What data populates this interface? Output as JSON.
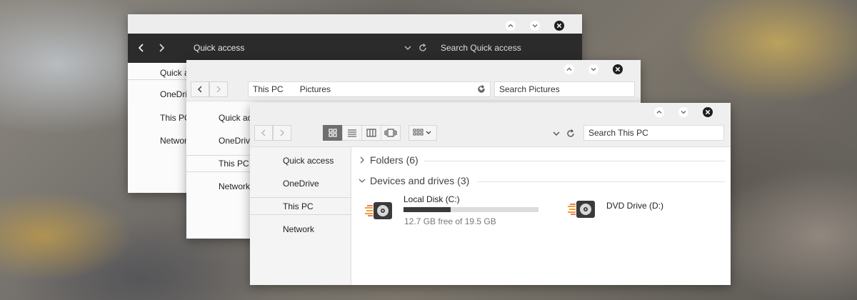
{
  "window_back": {
    "address": "Quick access",
    "search_placeholder": "Search Quick access",
    "sidebar": [
      "Quick access",
      "OneDrive",
      "This PC",
      "Network"
    ]
  },
  "window_middle": {
    "breadcrumb": [
      "This PC",
      "Pictures"
    ],
    "search_placeholder": "Search Pictures",
    "sidebar": [
      "Quick access",
      "OneDrive",
      "This PC",
      "Network"
    ]
  },
  "window_front": {
    "search_placeholder": "Search This PC",
    "sidebar": [
      "Quick access",
      "OneDrive",
      "This PC",
      "Network"
    ],
    "groups": {
      "folders": "Folders (6)",
      "devices": "Devices and drives (3)"
    },
    "drives": [
      {
        "name": "Local Disk (C:)",
        "free_text": "12.7 GB free of 19.5 GB",
        "used_fraction": 0.35
      },
      {
        "name": "DVD Drive (D:)"
      }
    ]
  },
  "icons": {
    "back": "chevron-left-icon",
    "forward": "chevron-right-icon",
    "refresh": "refresh-icon",
    "dropdown": "chevron-down-icon",
    "minimize": "chevron-up-icon",
    "maximize": "chevron-down-icon",
    "close": "close-icon"
  },
  "colors": {
    "dark_toolbar": "#2b2b2b",
    "drive_accent": "#f0a030",
    "usage_fill": "#3a3a3a"
  }
}
